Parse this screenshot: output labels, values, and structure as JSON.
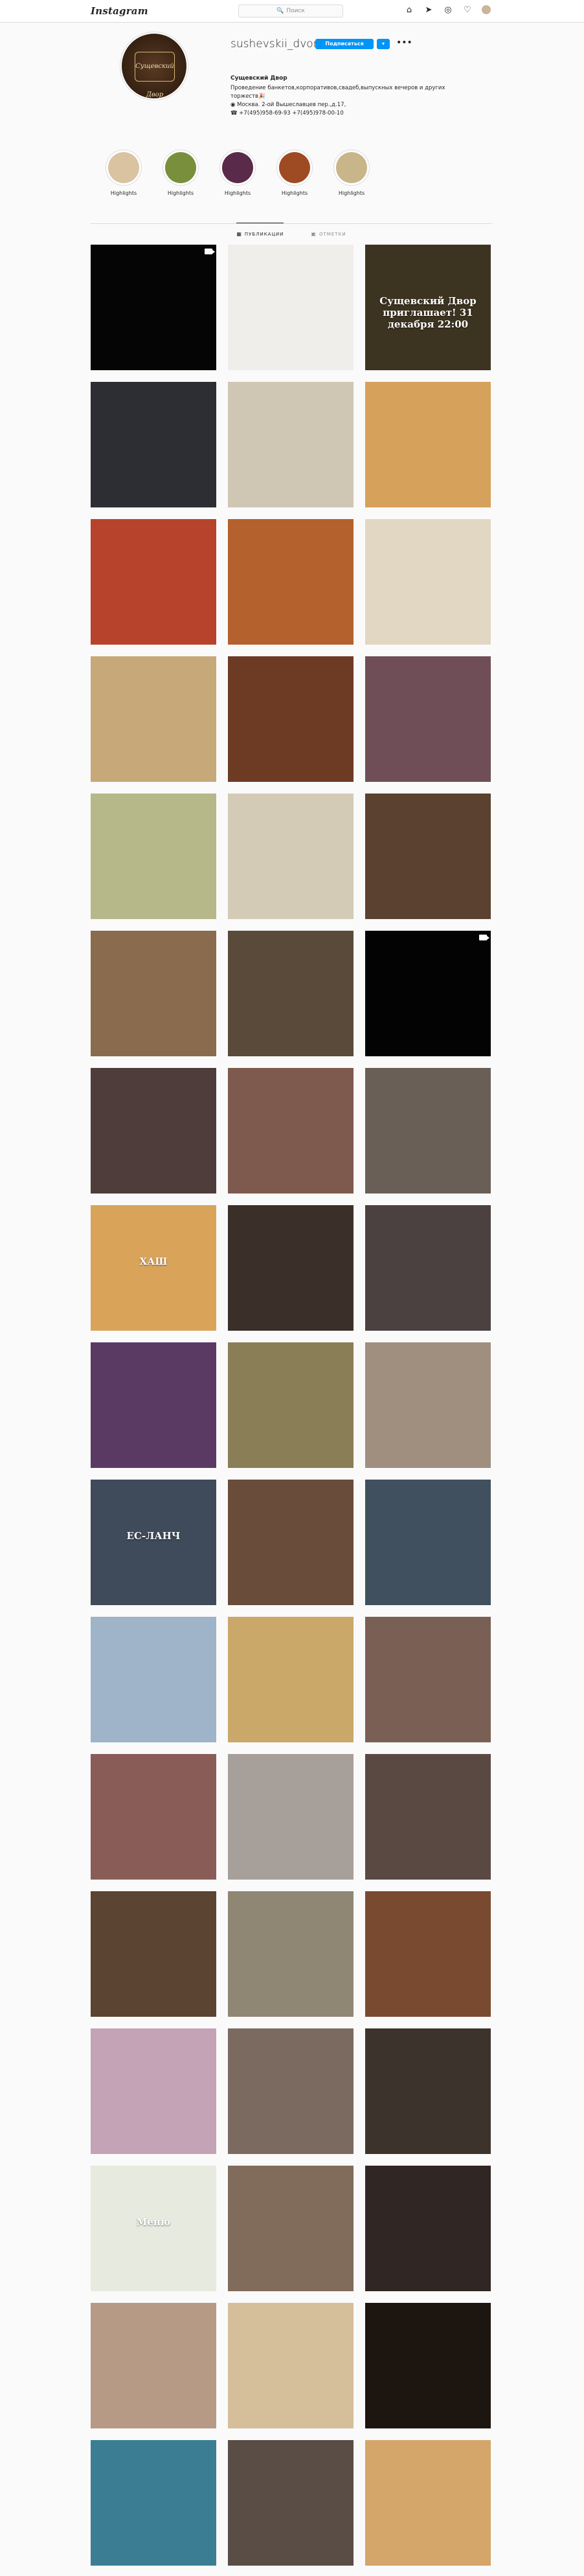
{
  "topbar": {
    "logo": "Instagram",
    "search_placeholder": "Поиск",
    "icons": [
      "home-icon",
      "direct-icon",
      "explore-icon",
      "heart-icon",
      "avatar"
    ]
  },
  "profile": {
    "username": "sushevskii_dvor",
    "follow_label": "Подписаться",
    "dropdown_glyph": "▾",
    "more_glyph": "•••",
    "full_name": "Сущевский Двор",
    "bio_lines": [
      "Проведение банкетов,корпоративов,свадеб,выпускных вечеров и других",
      "торжеств🎉",
      "Москва. 2-ой Вышеславцев пер.,д.17,",
      "+7(495)958-69-93 +7(495)978-00-10"
    ],
    "avatar_text": "Сущевский Двор"
  },
  "highlights": [
    {
      "label": "Highlights",
      "color": "#d9c3a1"
    },
    {
      "label": "Highlights",
      "color": "#7a8f3c"
    },
    {
      "label": "Highlights",
      "color": "#5a2a4a"
    },
    {
      "label": "Highlights",
      "color": "#9e4b24"
    },
    {
      "label": "Highlights",
      "color": "#c9b58a"
    }
  ],
  "tabs": [
    {
      "label": "ПУБЛИКАЦИИ",
      "icon": "grid-icon",
      "active": true
    },
    {
      "label": "ОТМЕТКИ",
      "icon": "tagged-icon",
      "active": false
    }
  ],
  "posts": [
    {
      "bg": "#050505",
      "text": "",
      "video": true
    },
    {
      "bg": "#efeeea",
      "text": "",
      "video": false
    },
    {
      "bg": "#3d3321",
      "text": "Сущевский Двор приглашает! 31 декабря 22:00",
      "video": false
    },
    {
      "bg": "#2c2e33",
      "text": "",
      "video": false
    },
    {
      "bg": "#cfc6b4",
      "text": "",
      "video": false
    },
    {
      "bg": "#d6a15a",
      "text": "",
      "video": false
    },
    {
      "bg": "#b8432c",
      "text": "",
      "video": false
    },
    {
      "bg": "#b5612e",
      "text": "",
      "video": false
    },
    {
      "bg": "#e1d7c2",
      "text": "",
      "video": false
    },
    {
      "bg": "#c7a878",
      "text": "",
      "video": false
    },
    {
      "bg": "#6d3a24",
      "text": "",
      "video": false
    },
    {
      "bg": "#6f4e57",
      "text": "",
      "video": false
    },
    {
      "bg": "#b7b88a",
      "text": "",
      "video": false
    },
    {
      "bg": "#d3cbb6",
      "text": "",
      "video": false
    },
    {
      "bg": "#5b4130",
      "text": "",
      "video": false
    },
    {
      "bg": "#8b6b4e",
      "text": "",
      "video": false
    },
    {
      "bg": "#5a4a3a",
      "text": "",
      "video": false
    },
    {
      "bg": "#030303",
      "text": "",
      "video": true
    },
    {
      "bg": "#4e3d3a",
      "text": "",
      "video": false
    },
    {
      "bg": "#7e5a4e",
      "text": "",
      "video": false
    },
    {
      "bg": "#6a5f56",
      "text": "",
      "video": false
    },
    {
      "bg": "#d9a45a",
      "text": "ХАШ",
      "video": false
    },
    {
      "bg": "#3b3029",
      "text": "",
      "video": false
    },
    {
      "bg": "#4a4140",
      "text": "",
      "video": false
    },
    {
      "bg": "#5a3a63",
      "text": "",
      "video": false
    },
    {
      "bg": "#8a7e57",
      "text": "",
      "video": false
    },
    {
      "bg": "#a08f7f",
      "text": "",
      "video": false
    },
    {
      "bg": "#3f4a5a",
      "text": "ЕС-ЛАНЧ",
      "video": false
    },
    {
      "bg": "#6a4c3a",
      "text": "",
      "video": false
    },
    {
      "bg": "#41505e",
      "text": "",
      "video": false
    },
    {
      "bg": "#9fb3c9",
      "text": "",
      "video": false
    },
    {
      "bg": "#c9a86a",
      "text": "",
      "video": false
    },
    {
      "bg": "#7a5f55",
      "text": "",
      "video": false
    },
    {
      "bg": "#8a5c58",
      "text": "",
      "video": false
    },
    {
      "bg": "#a79f9a",
      "text": "",
      "video": false
    },
    {
      "bg": "#5a4843",
      "text": "",
      "video": false
    },
    {
      "bg": "#5b4431",
      "text": "",
      "video": false
    },
    {
      "bg": "#8f8774",
      "text": "",
      "video": false
    },
    {
      "bg": "#7a4a30",
      "text": "",
      "video": false
    },
    {
      "bg": "#c3a3b5",
      "text": "",
      "video": false
    },
    {
      "bg": "#7a6a60",
      "text": "",
      "video": false
    },
    {
      "bg": "#3d332d",
      "text": "",
      "video": false
    },
    {
      "bg": "#e7eadf",
      "text": "Меню",
      "video": false
    },
    {
      "bg": "#816b5b",
      "text": "",
      "video": false
    },
    {
      "bg": "#302624",
      "text": "",
      "video": false
    },
    {
      "bg": "#b79a86",
      "text": "",
      "video": false
    },
    {
      "bg": "#d5bf9a",
      "text": "",
      "video": false
    },
    {
      "bg": "#1d1510",
      "text": "",
      "video": false
    },
    {
      "bg": "#3b7e93",
      "text": "",
      "video": false
    },
    {
      "bg": "#5a4d45",
      "text": "",
      "video": false
    },
    {
      "bg": "#d4a66a",
      "text": "",
      "video": false
    }
  ]
}
